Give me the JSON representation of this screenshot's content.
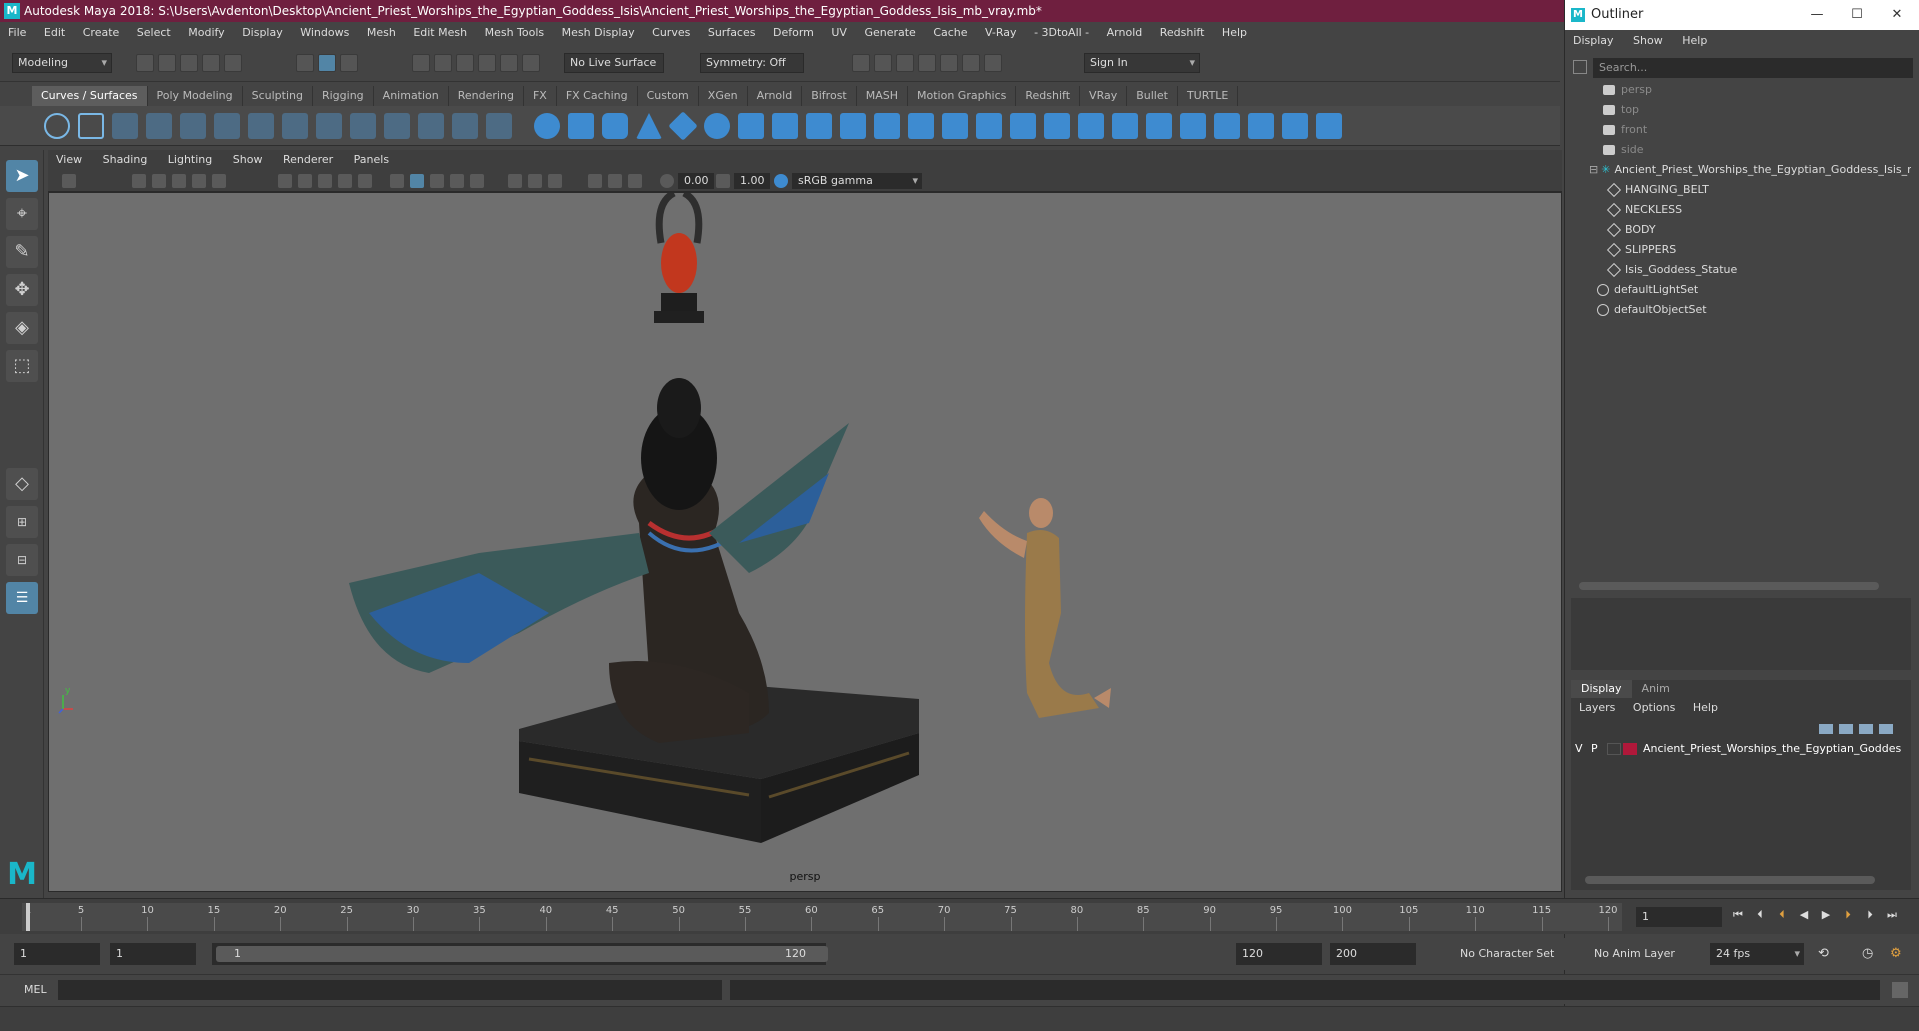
{
  "window": {
    "title": "Autodesk Maya 2018: S:\\Users\\Avdenton\\Desktop\\Ancient_Priest_Worships_the_Egyptian_Goddess_Isis\\Ancient_Priest_Worships_the_Egyptian_Goddess_Isis_mb_vray.mb*"
  },
  "menubar": [
    "File",
    "Edit",
    "Create",
    "Select",
    "Modify",
    "Display",
    "Windows",
    "Mesh",
    "Edit Mesh",
    "Mesh Tools",
    "Mesh Display",
    "Curves",
    "Surfaces",
    "Deform",
    "UV",
    "Generate",
    "Cache",
    "V-Ray",
    "- 3DtoAll -",
    "Arnold",
    "Redshift",
    "Help"
  ],
  "statusline": {
    "mode": "Modeling",
    "live_surface": "No Live Surface",
    "symmetry": "Symmetry: Off",
    "sign_in": "Sign In"
  },
  "shelf_tabs": [
    "Curves / Surfaces",
    "Poly Modeling",
    "Sculpting",
    "Rigging",
    "Animation",
    "Rendering",
    "FX",
    "FX Caching",
    "Custom",
    "XGen",
    "Arnold",
    "Bifrost",
    "MASH",
    "Motion Graphics",
    "Redshift",
    "VRay",
    "Bullet",
    "TURTLE"
  ],
  "viewport": {
    "menu": [
      "View",
      "Shading",
      "Lighting",
      "Show",
      "Renderer",
      "Panels"
    ],
    "exposure": "0.00",
    "gamma": "1.00",
    "colorspace": "sRGB gamma",
    "camera_label": "persp",
    "axis_y": "y"
  },
  "outliner": {
    "title": "Outliner",
    "menu": [
      "Display",
      "Show",
      "Help"
    ],
    "search_placeholder": "Search...",
    "cameras": [
      "persp",
      "top",
      "front",
      "side"
    ],
    "root": "Ancient_Priest_Worships_the_Egyptian_Goddess_Isis_nc",
    "children": [
      "HANGING_BELT",
      "NECKLESS",
      "BODY",
      "SLIPPERS",
      "Isis_Goddess_Statue"
    ],
    "sets": [
      "defaultLightSet",
      "defaultObjectSet"
    ]
  },
  "layers": {
    "tabs": [
      "Display",
      "Anim"
    ],
    "menu": [
      "Layers",
      "Options",
      "Help"
    ],
    "row": {
      "v": "V",
      "p": "P",
      "name": "Ancient_Priest_Worships_the_Egyptian_Goddes",
      "color": "#b0183a"
    }
  },
  "timeline": {
    "ticks": [
      "1",
      "5",
      "10",
      "15",
      "20",
      "25",
      "30",
      "35",
      "40",
      "45",
      "50",
      "55",
      "60",
      "65",
      "70",
      "75",
      "80",
      "85",
      "90",
      "95",
      "100",
      "105",
      "110",
      "115",
      "120"
    ],
    "current_frame": "1"
  },
  "range": {
    "start": "1",
    "playback_start": "1",
    "slider_start": "1",
    "slider_end": "120",
    "playback_end": "120",
    "end": "200",
    "character_set": "No Character Set",
    "anim_layer": "No Anim Layer",
    "fps": "24 fps"
  },
  "cmdline": {
    "label": "MEL"
  }
}
